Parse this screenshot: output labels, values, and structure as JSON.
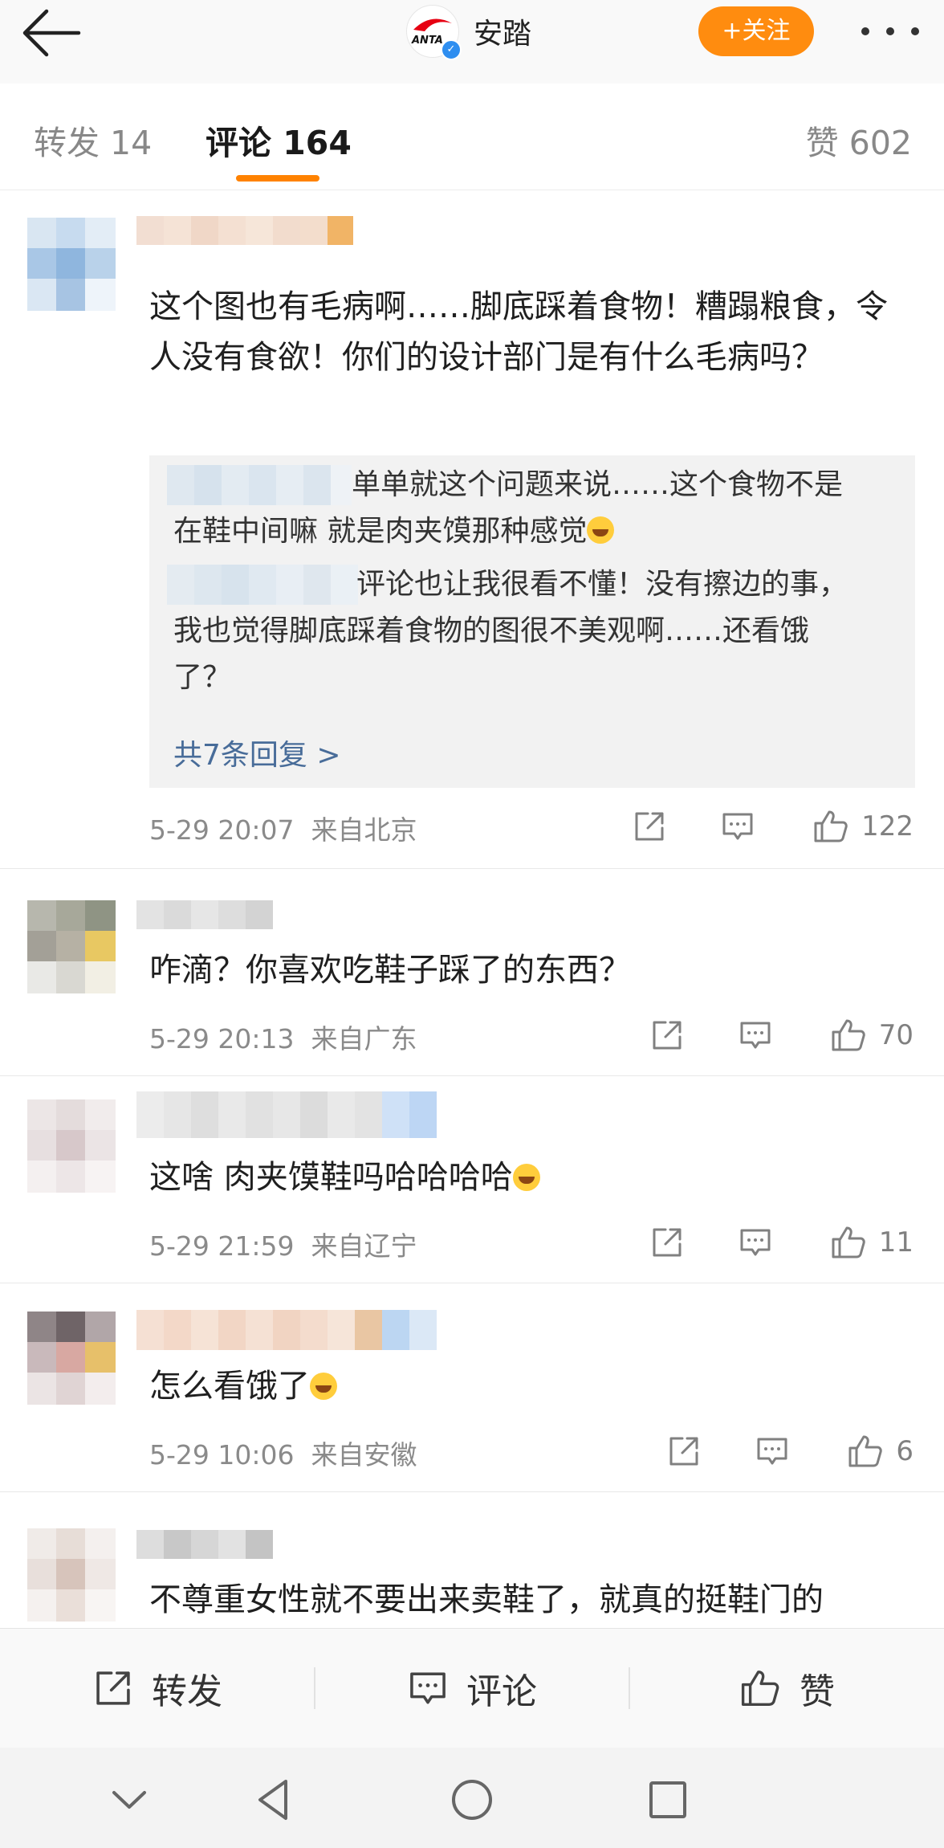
{
  "header": {
    "brand_name": "安踏",
    "logo_text": "ANTA",
    "follow_label": "+关注",
    "accent_color": "#ff8c0f"
  },
  "tabs": {
    "repost": "转发 14",
    "comment": "评论 164",
    "like": "赞 602"
  },
  "comments": [
    {
      "text": "这个图也有毛病啊……脚底踩着食物！糟蹋粮食，令人没有食欲！你们的设计部门是有什么毛病吗？",
      "time": "5-29 20:07",
      "location": "来自北京",
      "likes": "122",
      "replies": [
        {
          "line1": "单单就这个问题来说……这个食物不是",
          "line2": "在鞋中间嘛  就是肉夹馍那种感觉"
        },
        {
          "line1": "评论也让我很看不懂！没有擦边的事，",
          "line2": "我也觉得脚底踩着食物的图很不美观啊……还看饿",
          "line3": "了？"
        }
      ],
      "reply_more": "共7条回复 >"
    },
    {
      "text": "咋滴？你喜欢吃鞋子踩了的东西？",
      "time": "5-29 20:13",
      "location": "来自广东",
      "likes": "70"
    },
    {
      "text": "这啥 肉夹馍鞋吗哈哈哈哈",
      "time": "5-29 21:59",
      "location": "来自辽宁",
      "likes": "11"
    },
    {
      "text": "怎么看饿了",
      "time": "5-29 10:06",
      "location": "来自安徽",
      "likes": "6"
    },
    {
      "text": "不尊重女性就不要出来卖鞋了，就真的挺鞋门的"
    }
  ],
  "bottom_bar": {
    "repost": "转发",
    "comment": "评论",
    "like": "赞"
  },
  "icons": {
    "back": "back-arrow-icon",
    "more": "more-dots-icon",
    "share": "share-icon",
    "comment": "comment-icon",
    "like": "thumbs-up-icon"
  }
}
